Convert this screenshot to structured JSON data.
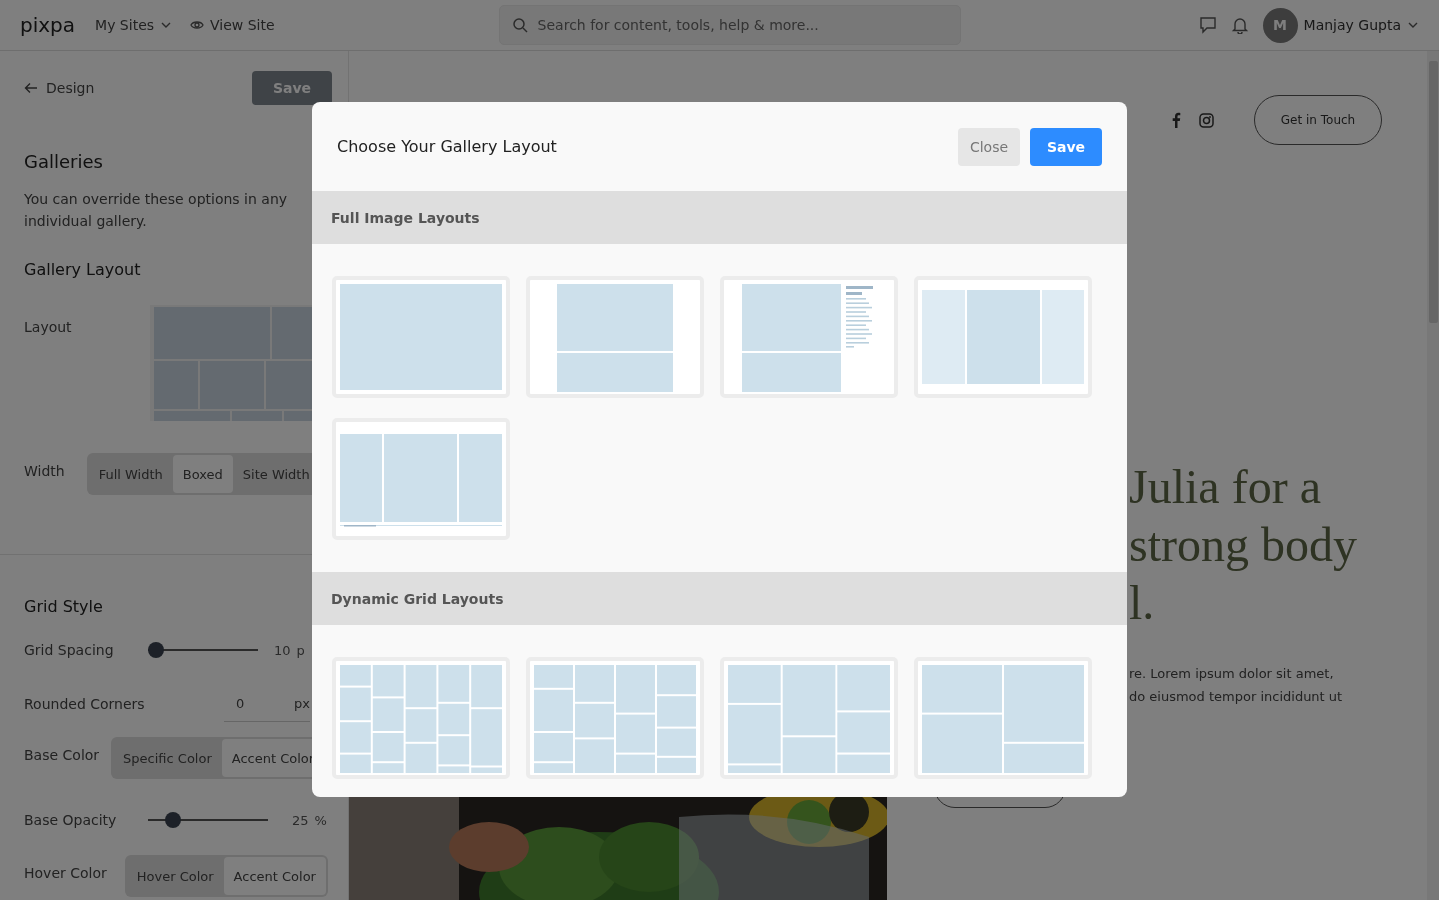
{
  "topbar": {
    "logo": "pixpa",
    "menu": [
      {
        "label": "My Sites",
        "dropdown": true
      },
      {
        "label": "View Site",
        "dropdown": false
      }
    ],
    "search": {
      "placeholder": "Search for content, tools, help & more..."
    },
    "user": {
      "initial": "M",
      "name": "Manjay Gupta"
    }
  },
  "panel": {
    "back": "Design",
    "save": "Save",
    "title": "Galleries",
    "description": "You can override these options in any individual gallery.",
    "layout_heading": "Gallery Layout",
    "layout_label": "Layout",
    "width": {
      "label": "Width",
      "options": [
        {
          "label": "Full Width",
          "selected": false
        },
        {
          "label": "Boxed",
          "selected": true
        },
        {
          "label": "Site Width",
          "selected": false
        }
      ]
    },
    "grid_heading": "Grid Style",
    "controls": [
      {
        "kind": "slider",
        "label": "Grid Spacing",
        "level": 0.07,
        "reading": "10",
        "unit": "p"
      },
      {
        "kind": "input",
        "label": "Rounded Corners",
        "value": "0",
        "unit": "px"
      },
      {
        "kind": "segmented",
        "label": "Base Color",
        "options": [
          {
            "label": "Specific Color",
            "selected": false
          },
          {
            "label": "Accent Color",
            "selected": true
          }
        ]
      },
      {
        "kind": "slider",
        "label": "Base Opacity",
        "level": 0.21,
        "reading": "25",
        "unit": "%"
      },
      {
        "kind": "segmented",
        "label": "Hover Color",
        "options": [
          {
            "label": "Hover Color",
            "selected": false
          },
          {
            "label": "Accent Color",
            "selected": true
          }
        ]
      }
    ]
  },
  "preview": {
    "button": "Get in Touch",
    "heading_lines": [
      "Julia for a",
      "strong body",
      "l."
    ],
    "text_lines": [
      "re. Lorem ipsum dolor sit amet,",
      "do eiusmod tempor incididunt ut"
    ]
  },
  "modal": {
    "title": "Choose Your Gallery Layout",
    "close": "Close",
    "save": "Save",
    "sections": [
      {
        "title": "Full Image Layouts",
        "layouts": [
          {
            "kind": "full"
          },
          {
            "kind": "slideshow"
          },
          {
            "kind": "split-text"
          },
          {
            "kind": "carousel"
          },
          {
            "kind": "filmstrip"
          }
        ]
      },
      {
        "title": "Dynamic Grid Layouts",
        "layouts": [
          {
            "kind": "mosaic-5"
          },
          {
            "kind": "mosaic-4"
          },
          {
            "kind": "mosaic-3"
          },
          {
            "kind": "mosaic-2"
          }
        ]
      }
    ]
  }
}
